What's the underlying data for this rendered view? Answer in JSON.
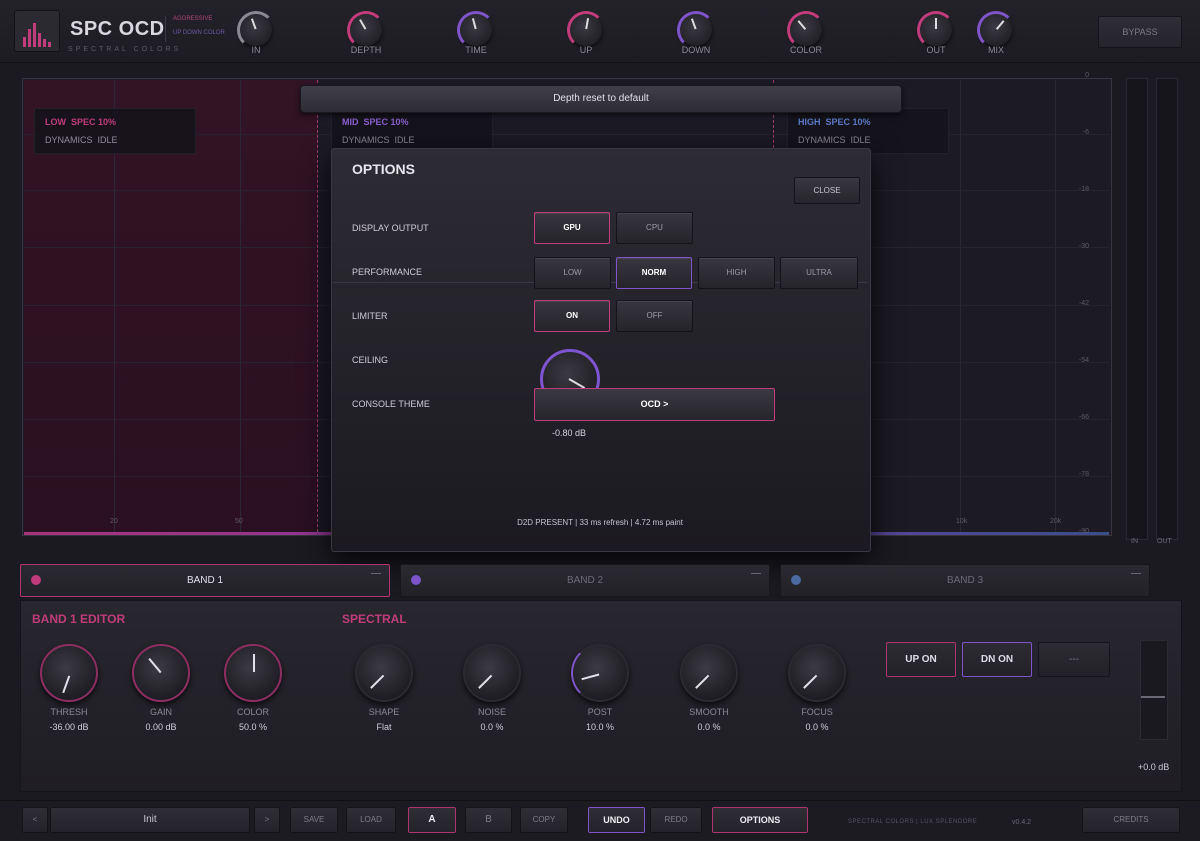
{
  "header": {
    "title": "SPC OCD",
    "subtitle": "SPECTRAL COLORS",
    "tag_top": "AGGRESSIVE",
    "tag_bottom": "UP DOWN COLOR",
    "knobs": [
      {
        "label": "IN",
        "color": "#8a8a92",
        "angle": -20
      },
      {
        "label": "DEPTH",
        "color": "#c03c7c",
        "angle": -30
      },
      {
        "label": "TIME",
        "color": "#7e55c8",
        "angle": -15
      },
      {
        "label": "UP",
        "color": "#c03c7c",
        "angle": 10
      },
      {
        "label": "DOWN",
        "color": "#7e55c8",
        "angle": -20
      },
      {
        "label": "COLOR",
        "color": "#c03c7c",
        "angle": -40
      },
      {
        "label": "OUT",
        "color": "#c03c7c",
        "angle": 0
      },
      {
        "label": "MIX",
        "color": "#7e55c8",
        "angle": 40
      }
    ],
    "bypass_label": "BYPASS"
  },
  "analyzer": {
    "bands": [
      {
        "name": "LOW",
        "spec": "SPEC 10%",
        "dynamics": "DYNAMICS",
        "state": "IDLE",
        "color": "#c03c7c"
      },
      {
        "name": "MID",
        "spec": "SPEC 10%",
        "dynamics": "DYNAMICS",
        "state": "IDLE",
        "color": "#8a5fd0"
      },
      {
        "name": "HIGH",
        "spec": "SPEC 10%",
        "dynamics": "DYNAMICS",
        "state": "IDLE",
        "color": "#5a7ac8"
      }
    ],
    "hz_labels": [
      "20",
      "50",
      "10k",
      "20k"
    ],
    "db_labels": [
      "0",
      "-6",
      "-18",
      "-30",
      "-42",
      "-54",
      "-66",
      "-78",
      "-90"
    ],
    "meter_in": "IN",
    "meter_out": "OUT"
  },
  "toast": "Depth reset to default",
  "options": {
    "title": "OPTIONS",
    "close_label": "CLOSE",
    "display_output": {
      "label": "DISPLAY OUTPUT",
      "choices": [
        "GPU",
        "CPU"
      ],
      "selected": "GPU"
    },
    "performance": {
      "label": "PERFORMANCE",
      "choices": [
        "LOW",
        "NORM",
        "HIGH",
        "ULTRA"
      ],
      "selected": "NORM"
    },
    "limiter": {
      "label": "LIMITER",
      "choices": [
        "ON",
        "OFF"
      ],
      "selected": "ON"
    },
    "ceiling": {
      "label": "CEILING",
      "value": "-0.80 dB"
    },
    "console_theme": {
      "label": "CONSOLE THEME",
      "value": "OCD  >"
    },
    "footer": "D2D PRESENT  |  33 ms refresh  |  4.72 ms paint"
  },
  "band_tabs": [
    {
      "label": "BAND 1",
      "color": "#c03c7c",
      "active": true
    },
    {
      "label": "BAND 2",
      "color": "#7e55c8",
      "active": false
    },
    {
      "label": "BAND 3",
      "color": "#4a6aa0",
      "active": false
    }
  ],
  "editor": {
    "band_title": "BAND 1 EDITOR",
    "spectral_title": "SPECTRAL",
    "band_knobs": [
      {
        "label": "THRESH",
        "value": "-36.00 dB"
      },
      {
        "label": "GAIN",
        "value": "0.00 dB"
      },
      {
        "label": "COLOR",
        "value": "50.0 %"
      }
    ],
    "spectral_knobs": [
      {
        "label": "SHAPE",
        "value": "Flat"
      },
      {
        "label": "NOISE",
        "value": "0.0 %"
      },
      {
        "label": "POST",
        "value": "10.0 %"
      },
      {
        "label": "SMOOTH",
        "value": "0.0 %"
      },
      {
        "label": "FOCUS",
        "value": "0.0 %"
      }
    ],
    "up_on": "UP ON",
    "dn_on": "DN ON",
    "extra_btn": "---",
    "fader_value": "+0.0 dB"
  },
  "bottom": {
    "prev": "<",
    "preset": "Init",
    "next": ">",
    "save": "SAVE",
    "load": "LOAD",
    "a": "A",
    "b": "B",
    "copy": "COPY",
    "undo": "UNDO",
    "redo": "REDO",
    "options": "OPTIONS",
    "brand": "SPECTRAL COLORS  |  LUX SPLENDORE",
    "version": "v0.4.2",
    "credits": "CREDITS"
  }
}
